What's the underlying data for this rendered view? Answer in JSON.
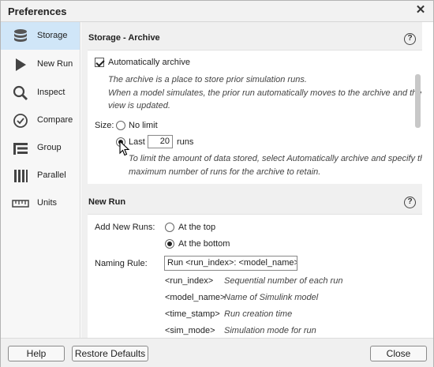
{
  "window": {
    "title": "Preferences"
  },
  "sidebar": {
    "items": [
      {
        "label": "Storage",
        "icon": "database-icon",
        "active": true
      },
      {
        "label": "New Run",
        "icon": "play-icon"
      },
      {
        "label": "Inspect",
        "icon": "magnifier-icon"
      },
      {
        "label": "Compare",
        "icon": "check-circle-icon"
      },
      {
        "label": "Group",
        "icon": "group-bars-icon"
      },
      {
        "label": "Parallel",
        "icon": "parallel-bars-icon"
      },
      {
        "label": "Units",
        "icon": "ruler-icon"
      }
    ]
  },
  "archive": {
    "title": "Storage - Archive",
    "auto_archive_label": "Automatically archive",
    "desc1": "The archive is a place to store prior simulation runs.",
    "desc2": "When a model simulates, the prior run automatically moves to the archive and the",
    "desc3": "view is updated.",
    "size_label": "Size:",
    "no_limit_label": "No limit",
    "last_label": "Last",
    "last_value": "20",
    "runs_label": "runs",
    "hint1": "To limit the amount of data stored, select Automatically archive and specify the",
    "hint2": "maximum number of runs for the archive to retain."
  },
  "new_run": {
    "title": "New Run",
    "add_label": "Add New Runs:",
    "opt_top": "At the top",
    "opt_bottom": "At the bottom",
    "naming_label": "Naming Rule:",
    "naming_value": "Run <run_index>: <model_name>",
    "tokens": [
      {
        "token": "<run_index>",
        "desc": "Sequential number of each run"
      },
      {
        "token": "<model_name>",
        "desc": "Name of Simulink model"
      },
      {
        "token": "<time_stamp>",
        "desc": "Run creation time"
      },
      {
        "token": "<sim_mode>",
        "desc": "Simulation mode for run"
      }
    ]
  },
  "footer": {
    "help": "Help",
    "restore": "Restore Defaults",
    "close": "Close"
  },
  "colors": {
    "active_nav": "#d0e6f8",
    "panel_bg": "#f0f0f0"
  }
}
